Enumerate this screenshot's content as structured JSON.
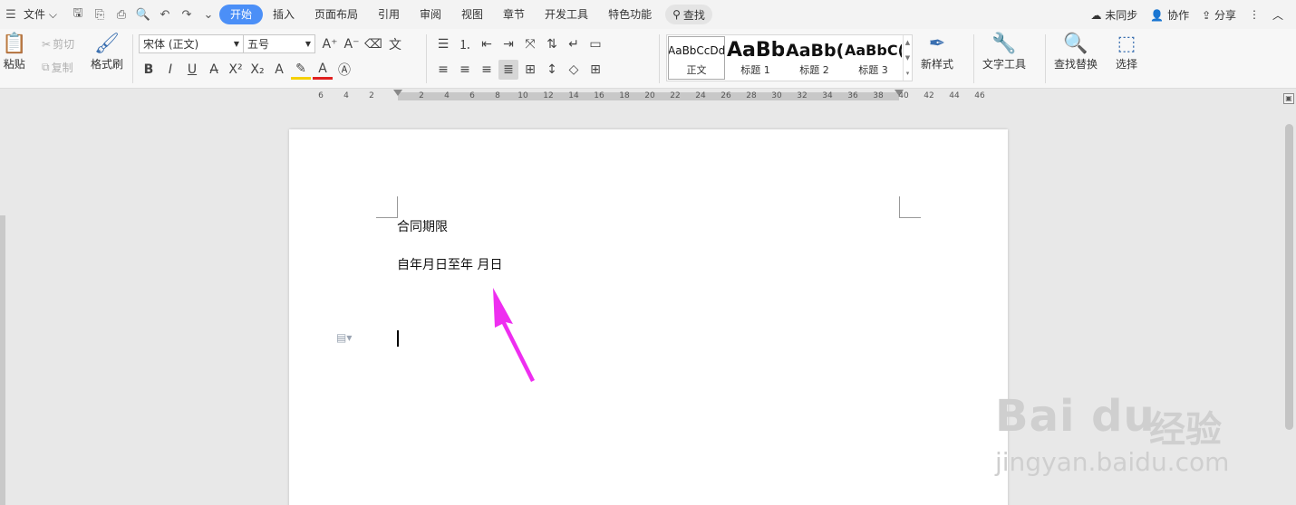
{
  "menu": {
    "file_label": "文件",
    "tabs": [
      "开始",
      "插入",
      "页面布局",
      "引用",
      "审阅",
      "视图",
      "章节",
      "开发工具",
      "特色功能"
    ],
    "search_label": "查找",
    "right": {
      "sync": "未同步",
      "collab": "协作",
      "share": "分享"
    }
  },
  "ribbon": {
    "paste": "粘贴",
    "cut": "剪切",
    "copy": "复制",
    "format_painter": "格式刷",
    "font_name": "宋体 (正文)",
    "font_size": "五号",
    "styles": [
      {
        "preview": "AaBbCcDd",
        "name": "正文"
      },
      {
        "preview": "AaBb",
        "name": "标题 1"
      },
      {
        "preview": "AaBb(",
        "name": "标题 2"
      },
      {
        "preview": "AaBbC(",
        "name": "标题 3"
      }
    ],
    "new_style": "新样式",
    "text_tools": "文字工具",
    "find_replace": "查找替换",
    "select": "选择"
  },
  "ruler": {
    "numbers": [
      "6",
      "4",
      "2",
      "2",
      "4",
      "6",
      "8",
      "10",
      "12",
      "14",
      "16",
      "18",
      "20",
      "22",
      "24",
      "26",
      "28",
      "30",
      "32",
      "34",
      "36",
      "38",
      "40",
      "42",
      "44",
      "46"
    ]
  },
  "document": {
    "line1": "合同期限",
    "line2": "自年月日至年  月日"
  },
  "annotation": {
    "arrow_color": "#ee2ef0"
  },
  "watermark": {
    "brand": "Bai du",
    "cn": "经验",
    "url": "jingyan.baidu.com"
  },
  "colors": {
    "accent": "#4b8ff7",
    "font_color": "#e02020",
    "highlight": "#f5d000"
  }
}
